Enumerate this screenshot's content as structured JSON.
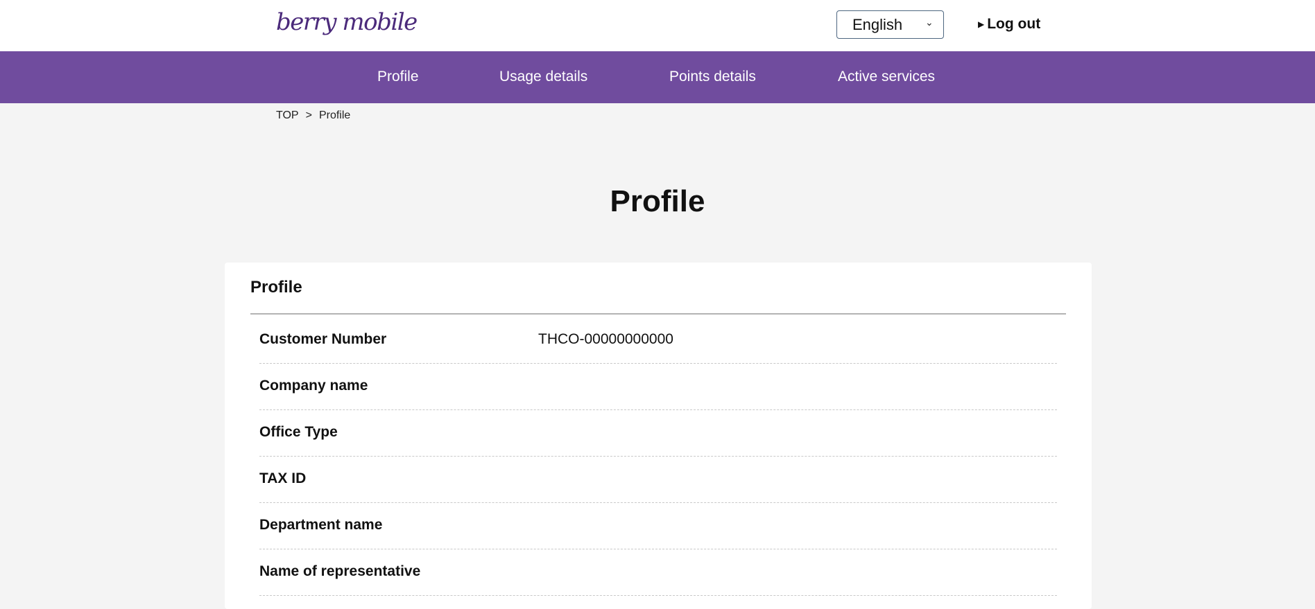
{
  "header": {
    "logo_text": "berry mobile",
    "language": {
      "selected": "English",
      "options": [
        "English"
      ]
    },
    "logout_label": "Log out"
  },
  "nav": {
    "items": [
      "Profile",
      "Usage details",
      "Points details",
      "Active services"
    ]
  },
  "breadcrumb": {
    "home": "TOP",
    "separator": ">",
    "current": "Profile"
  },
  "page_title": "Profile",
  "profile_card": {
    "title": "Profile",
    "rows": [
      {
        "label": "Customer Number",
        "value": "THCO-00000000000"
      },
      {
        "label": "Company name",
        "value": ""
      },
      {
        "label": "Office Type",
        "value": ""
      },
      {
        "label": "TAX ID",
        "value": ""
      },
      {
        "label": "Department name",
        "value": ""
      },
      {
        "label": "Name of representative",
        "value": ""
      }
    ]
  },
  "colors": {
    "brand_purple": "#704c9e",
    "logo_purple": "#4b2a7b",
    "page_background": "#f4f4f4"
  }
}
